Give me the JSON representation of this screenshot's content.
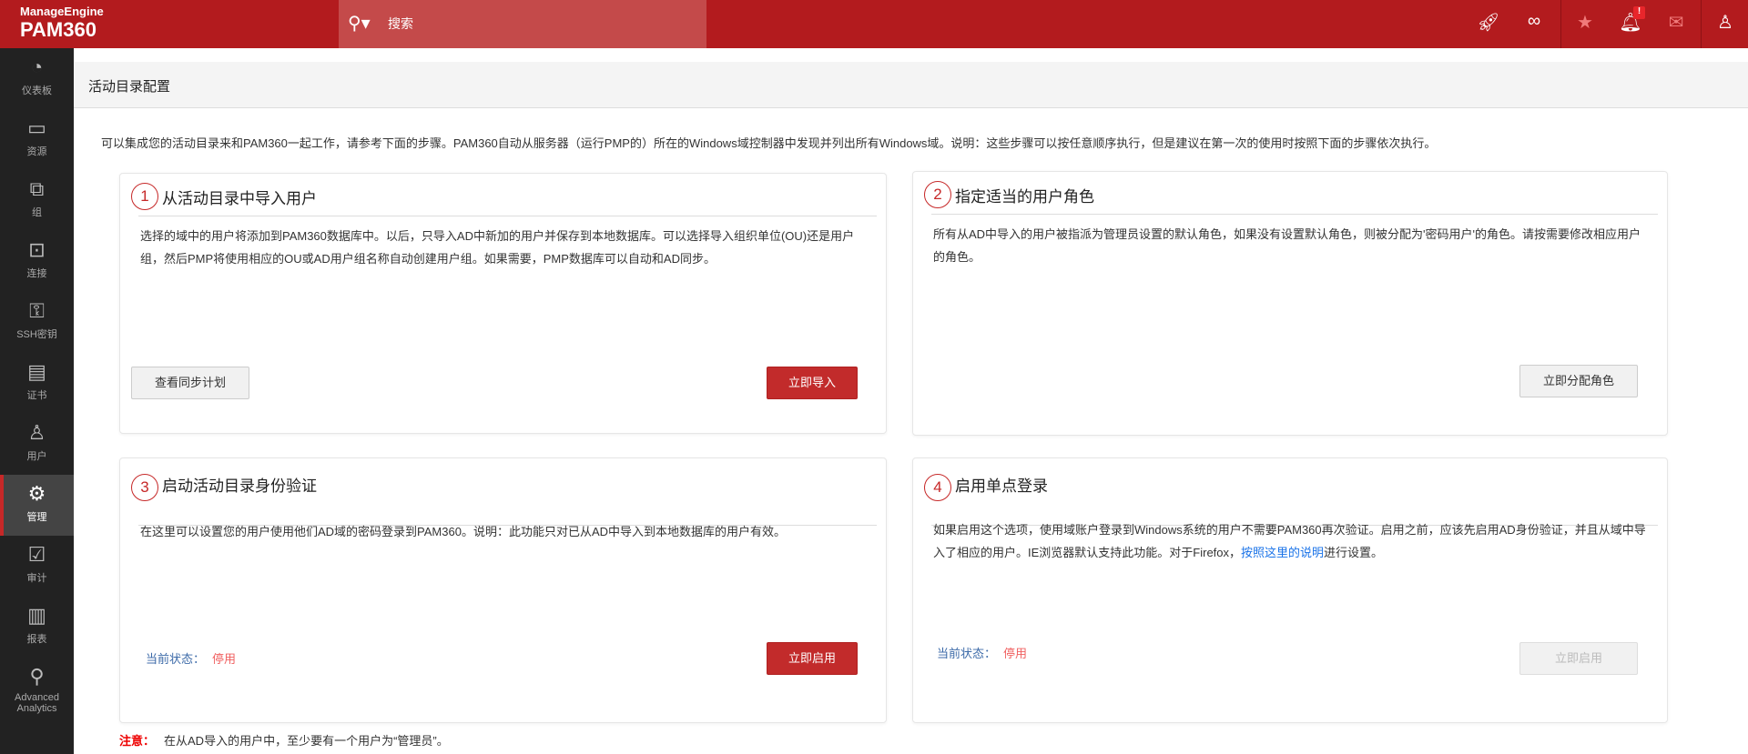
{
  "header": {
    "brand": "ManageEngine",
    "product": "PAM360",
    "search_placeholder": "搜索",
    "icons": [
      "rocket-icon",
      "link-icon",
      "user-star-icon",
      "bell-icon",
      "mail-icon",
      "user-icon"
    ],
    "bell_badge": "!"
  },
  "sidebar": {
    "items": [
      {
        "label": "仪表板",
        "icon": "◔"
      },
      {
        "label": "资源",
        "icon": "▭"
      },
      {
        "label": "组",
        "icon": "⧉"
      },
      {
        "label": "连接",
        "icon": "⊡"
      },
      {
        "label": "SSH密钥",
        "icon": "⚿"
      },
      {
        "label": "证书",
        "icon": "▤"
      },
      {
        "label": "用户",
        "icon": "♙"
      },
      {
        "label": "管理",
        "icon": "⚙",
        "active": true
      },
      {
        "label": "审计",
        "icon": "☑"
      },
      {
        "label": "报表",
        "icon": "▥"
      },
      {
        "label": "Advanced Analytics",
        "icon": "⚲"
      }
    ]
  },
  "page": {
    "title": "活动目录配置",
    "intro": "可以集成您的活动目录来和PAM360一起工作，请参考下面的步骤。PAM360自动从服务器（运行PMP的）所在的Windows域控制器中发现并列出所有Windows域。说明：这些步骤可以按任意顺序执行，但是建议在第一次的使用时按照下面的步骤依次执行。"
  },
  "cards": [
    {
      "num": "1",
      "title": "从活动目录中导入用户",
      "body": "选择的域中的用户将添加到PAM360数据库中。以后，只导入AD中新加的用户并保存到本地数据库。可以选择导入组织单位(OU)还是用户组，然后PMP将使用相应的OU或AD用户组名称自动创建用户组。如果需要，PMP数据库可以自动和AD同步。",
      "btn_secondary": "查看同步计划",
      "btn_primary": "立即导入"
    },
    {
      "num": "2",
      "title": "指定适当的用户角色",
      "body": "所有从AD中导入的用户被指派为管理员设置的默认角色，如果没有设置默认角色，则被分配为'密码用户'的角色。请按需要修改相应用户的角色。",
      "btn_primary": "立即分配角色"
    },
    {
      "num": "3",
      "title": "启动活动目录身份验证",
      "body": "在这里可以设置您的用户使用他们AD域的密码登录到PAM360。说明：此功能只对已从AD中导入到本地数据库的用户有效。",
      "status_label": "当前状态：",
      "status_value": "停用",
      "btn_primary": "立即启用"
    },
    {
      "num": "4",
      "title": "启用单点登录",
      "body": "如果启用这个选项，使用域账户登录到Windows系统的用户不需要PAM360再次验证。启用之前，应该先启用AD身份验证，并且从域中导入了相应的用户。IE浏览器默认支持此功能。对于Firefox，",
      "link": "按照这里的说明",
      "body_end": "进行设置。",
      "status_label": "当前状态：",
      "status_value": "停用",
      "btn_primary": "立即启用"
    }
  ],
  "note": {
    "label": "注意：",
    "text": "在从AD导入的用户中，至少要有一个用户为“管理员”。"
  }
}
